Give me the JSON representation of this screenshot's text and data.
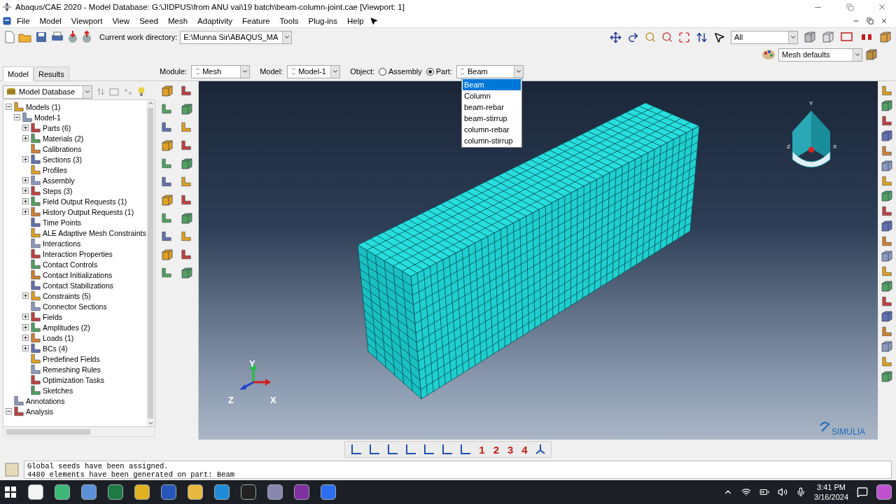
{
  "window": {
    "title": "Abaqus/CAE 2020 - Model Database: G:\\JIDPUS\\from ANU vai\\19 batch\\beam-column-joint.cae [Viewport: 1]"
  },
  "menu": [
    "File",
    "Model",
    "Viewport",
    "View",
    "Seed",
    "Mesh",
    "Adaptivity",
    "Feature",
    "Tools",
    "Plug-ins",
    "Help"
  ],
  "toolbar": {
    "directory_label": "Current work directory:",
    "directory": "E:\\Munna Sir\\ABAQUS_MA",
    "selection": "All",
    "render_style": "Mesh defaults"
  },
  "tabs": [
    {
      "label": "Model",
      "selected": true
    },
    {
      "label": "Results",
      "selected": false
    }
  ],
  "context": {
    "module_label": "Module:",
    "module": "Mesh",
    "model_label": "Model:",
    "model": "Model-1",
    "object_label": "Object:",
    "objects": [
      {
        "label": "Assembly",
        "selected": false
      },
      {
        "label": "Part:",
        "selected": true
      }
    ],
    "part": "Beam"
  },
  "part_menu": [
    {
      "label": "Beam",
      "selected": true
    },
    {
      "label": "Column",
      "selected": false
    },
    {
      "label": "beam-rebar",
      "selected": false
    },
    {
      "label": "beam-stirrup",
      "selected": false
    },
    {
      "label": "column-rebar",
      "selected": false
    },
    {
      "label": "column-stirrup",
      "selected": false
    }
  ],
  "tree": {
    "database": "Model Database",
    "items": [
      {
        "label": "Models (1)",
        "kind": "branch",
        "expanded": true,
        "children": [
          {
            "label": "Model-1",
            "kind": "branch",
            "expanded": true,
            "children": [
              {
                "label": "Parts (6)",
                "kind": "branch",
                "expanded": false
              },
              {
                "label": "Materials (2)",
                "kind": "branch",
                "expanded": false
              },
              {
                "label": "Calibrations",
                "kind": "leaf"
              },
              {
                "label": "Sections (3)",
                "kind": "branch",
                "expanded": false
              },
              {
                "label": "Profiles",
                "kind": "leaf"
              },
              {
                "label": "Assembly",
                "kind": "branch",
                "expanded": false
              },
              {
                "label": "Steps (3)",
                "kind": "branch",
                "expanded": false
              },
              {
                "label": "Field Output Requests (1)",
                "kind": "branch",
                "expanded": false
              },
              {
                "label": "History Output Requests (1)",
                "kind": "branch",
                "expanded": false
              },
              {
                "label": "Time Points",
                "kind": "leaf"
              },
              {
                "label": "ALE Adaptive Mesh Constraints",
                "kind": "leaf"
              },
              {
                "label": "Interactions",
                "kind": "leaf"
              },
              {
                "label": "Interaction Properties",
                "kind": "leaf"
              },
              {
                "label": "Contact Controls",
                "kind": "leaf"
              },
              {
                "label": "Contact Initializations",
                "kind": "leaf"
              },
              {
                "label": "Contact Stabilizations",
                "kind": "leaf"
              },
              {
                "label": "Constraints (5)",
                "kind": "branch",
                "expanded": false
              },
              {
                "label": "Connector Sections",
                "kind": "leaf"
              },
              {
                "label": "Fields",
                "kind": "branch",
                "expanded": false
              },
              {
                "label": "Amplitudes (2)",
                "kind": "branch",
                "expanded": false
              },
              {
                "label": "Loads (1)",
                "kind": "branch",
                "expanded": false
              },
              {
                "label": "BCs (4)",
                "kind": "branch",
                "expanded": false
              },
              {
                "label": "Predefined Fields",
                "kind": "leaf"
              },
              {
                "label": "Remeshing Rules",
                "kind": "leaf"
              },
              {
                "label": "Optimization Tasks",
                "kind": "leaf"
              },
              {
                "label": "Sketches",
                "kind": "leaf"
              }
            ]
          }
        ]
      },
      {
        "label": "Annotations",
        "kind": "leaf"
      },
      {
        "label": "Analysis",
        "kind": "branch",
        "expanded": true
      }
    ]
  },
  "viewport": {
    "triad": {
      "x": "X",
      "y": "Y",
      "z": "Z"
    },
    "cube": {
      "x": "X",
      "y": "Y",
      "z": "Z"
    },
    "logo": "SIMULIA"
  },
  "view_toolbar": [
    "1",
    "2",
    "3",
    "4"
  ],
  "messages": [
    "Global seeds have been assigned.",
    "4480 elements have been generated on part: Beam"
  ],
  "taskbar": {
    "time": "3:41 PM",
    "date": "3/16/2024"
  }
}
